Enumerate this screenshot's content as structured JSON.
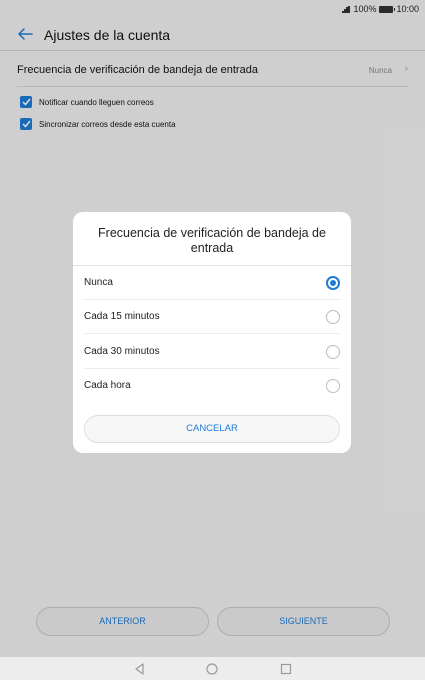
{
  "status_bar": {
    "battery": "100%",
    "time": "10:00"
  },
  "header": {
    "title": "Ajustes de la cuenta"
  },
  "settings": {
    "frequency_label": "Frecuencia de verificación de bandeja de entrada",
    "frequency_value": "Nunca",
    "checkboxes": [
      {
        "label": "Notificar cuando lleguen correos",
        "checked": true
      },
      {
        "label": "Sincronizar correos desde esta cuenta",
        "checked": true
      }
    ]
  },
  "dialog": {
    "title": "Frecuencia de verificación de bandeja de entrada",
    "options": [
      {
        "label": "Nunca",
        "selected": true
      },
      {
        "label": "Cada 15 minutos",
        "selected": false
      },
      {
        "label": "Cada 30 minutos",
        "selected": false
      },
      {
        "label": "Cada hora",
        "selected": false
      }
    ],
    "cancel_label": "CANCELAR"
  },
  "footer": {
    "prev_label": "ANTERIOR",
    "next_label": "SIGUIENTE"
  },
  "colors": {
    "accent": "#1e7cd6",
    "background": "#f2f2f2"
  },
  "icons": [
    "signal-icon",
    "battery-icon",
    "back-arrow-icon",
    "chevron-right-icon",
    "checkmark-icon",
    "nav-back-icon",
    "nav-home-icon",
    "nav-recents-icon"
  ]
}
